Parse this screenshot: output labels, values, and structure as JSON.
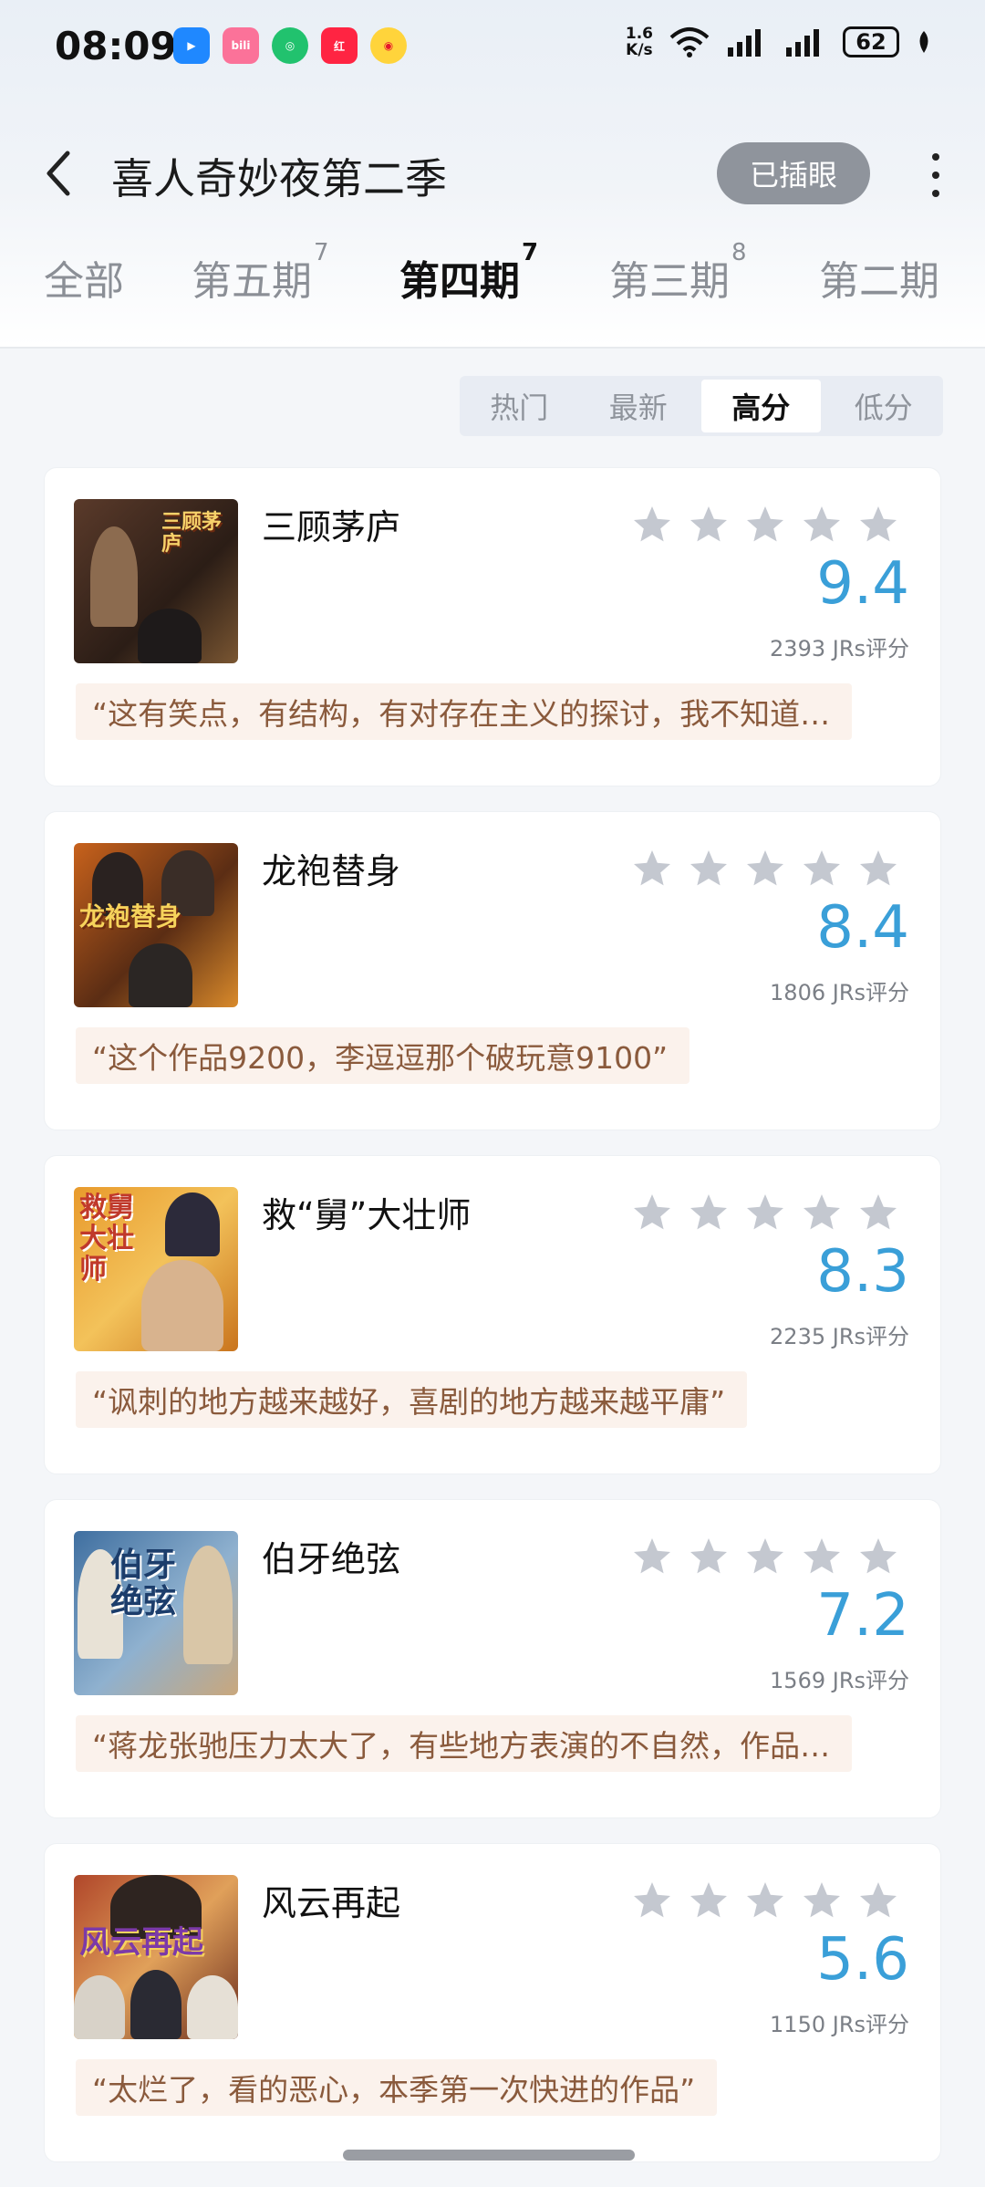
{
  "status_bar": {
    "time": "08:09",
    "net_speed_value": "1.6",
    "net_speed_unit": "K/s",
    "battery": "62",
    "app_icons": [
      "tencent-icon",
      "bilibili-icon",
      "green-app-icon",
      "xiaohongshu-icon",
      "weibo-icon"
    ]
  },
  "header": {
    "title": "喜人奇妙夜第二季",
    "mark_button": "已插眼"
  },
  "tabs": [
    {
      "label": "全部",
      "count": ""
    },
    {
      "label": "第五期",
      "count": "7"
    },
    {
      "label": "第四期",
      "count": "7"
    },
    {
      "label": "第三期",
      "count": "8"
    },
    {
      "label": "第二期",
      "count": ""
    }
  ],
  "active_tab_index": 2,
  "sort_options": [
    "热门",
    "最新",
    "高分",
    "低分"
  ],
  "active_sort_index": 2,
  "items": [
    {
      "name": "三顾茅庐",
      "score": "9.4",
      "count": "2393 JRs评分",
      "quote": "“这有笑点，有结构，有对存在主义的探讨，我不知道…",
      "thumb_text": "三顾茅庐"
    },
    {
      "name": "龙袍替身",
      "score": "8.4",
      "count": "1806 JRs评分",
      "quote": "“这个作品9200，李逗逗那个破玩意9100”",
      "thumb_text": "龙袍替身"
    },
    {
      "name": "救“舅”大壮师",
      "score": "8.3",
      "count": "2235 JRs评分",
      "quote": "“讽刺的地方越来越好，喜剧的地方越来越平庸”",
      "thumb_text": "救舅大壮师"
    },
    {
      "name": "伯牙绝弦",
      "score": "7.2",
      "count": "1569 JRs评分",
      "quote": "“蒋龙张驰压力太大了，有些地方表演的不自然，作品…",
      "thumb_text": "伯牙绝弦"
    },
    {
      "name": "风云再起",
      "score": "5.6",
      "count": "1150 JRs评分",
      "quote": "“太烂了，看的恶心，本季第一次快进的作品”",
      "thumb_text": "风云再起"
    }
  ],
  "colors": {
    "accent": "#3a9fd8",
    "mark_button_bg": "#8f949c",
    "quote_bg": "#fbf2ec",
    "quote_text": "#8a5a3c",
    "star": "#c4c8d0"
  }
}
